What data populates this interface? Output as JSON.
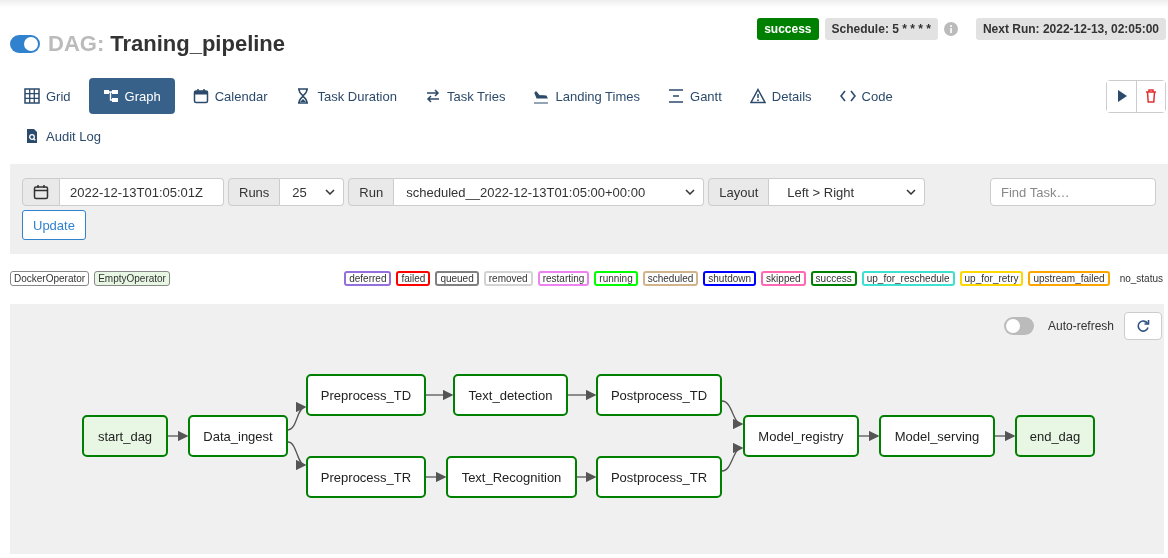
{
  "dag": {
    "active": true,
    "prefix": "DAG:",
    "name": "Traning_pipeline"
  },
  "header_badges": [
    {
      "kind": "status",
      "text": "success"
    },
    {
      "kind": "schedule",
      "text": "Schedule: 5 * * * *"
    },
    {
      "kind": "next",
      "text": "Next Run: 2022-12-13, 02:05:00"
    }
  ],
  "tabs": [
    {
      "label": "Grid",
      "selected": false
    },
    {
      "label": "Graph",
      "selected": true
    },
    {
      "label": "Calendar",
      "selected": false
    },
    {
      "label": "Task Duration",
      "selected": false
    },
    {
      "label": "Task Tries",
      "selected": false
    },
    {
      "label": "Landing Times",
      "selected": false
    },
    {
      "label": "Gantt",
      "selected": false
    },
    {
      "label": "Details",
      "selected": false
    },
    {
      "label": "Code",
      "selected": false
    },
    {
      "label": "Audit Log",
      "selected": false
    }
  ],
  "filters": {
    "date": "2022-12-13T01:05:01Z",
    "runs_label": "Runs",
    "runs": "25",
    "run_label": "Run",
    "run": "scheduled__2022-12-13T01:05:00+00:00",
    "layout_label": "Layout",
    "layout": "Left > Right",
    "update": "Update",
    "find_placeholder": "Find Task…"
  },
  "operators": [
    {
      "label": "DockerOperator",
      "color": "#ffffff"
    },
    {
      "label": "EmptyOperator",
      "color": "#e8f7e4"
    }
  ],
  "states": [
    {
      "label": "deferred",
      "color": "#9370db"
    },
    {
      "label": "failed",
      "color": "#ff0000"
    },
    {
      "label": "queued",
      "color": "#808080"
    },
    {
      "label": "removed",
      "color": "#d3d3d3"
    },
    {
      "label": "restarting",
      "color": "#ee82ee"
    },
    {
      "label": "running",
      "color": "#00ff00"
    },
    {
      "label": "scheduled",
      "color": "#d2b48c"
    },
    {
      "label": "shutdown",
      "color": "#0000ff"
    },
    {
      "label": "skipped",
      "color": "#ff69b4"
    },
    {
      "label": "success",
      "color": "#008000"
    },
    {
      "label": "up_for_reschedule",
      "color": "#40e0d0"
    },
    {
      "label": "up_for_retry",
      "color": "#ffd700"
    },
    {
      "label": "upstream_failed",
      "color": "#ffa500"
    },
    {
      "label": "no_status"
    }
  ],
  "graph": {
    "auto_refresh": {
      "label": "Auto-refresh",
      "on": false
    },
    "nodes": [
      {
        "label": "start_dag",
        "kind": "empty",
        "color": "#008000"
      },
      {
        "label": "Data_ingest",
        "kind": "docker",
        "color": "#008000"
      },
      {
        "label": "Preprocess_TD",
        "kind": "docker",
        "color": "#008000"
      },
      {
        "label": "Text_detection",
        "kind": "docker",
        "color": "#008000"
      },
      {
        "label": "Postprocess_TD",
        "kind": "docker",
        "color": "#008000"
      },
      {
        "label": "Preprocess_TR",
        "kind": "docker",
        "color": "#008000"
      },
      {
        "label": "Text_Recognition",
        "kind": "docker",
        "color": "#008000"
      },
      {
        "label": "Postprocess_TR",
        "kind": "docker",
        "color": "#008000"
      },
      {
        "label": "Model_registry",
        "kind": "docker",
        "color": "#008000"
      },
      {
        "label": "Model_serving",
        "kind": "docker",
        "color": "#008000"
      },
      {
        "label": "end_dag",
        "kind": "empty",
        "color": "#008000"
      }
    ]
  }
}
